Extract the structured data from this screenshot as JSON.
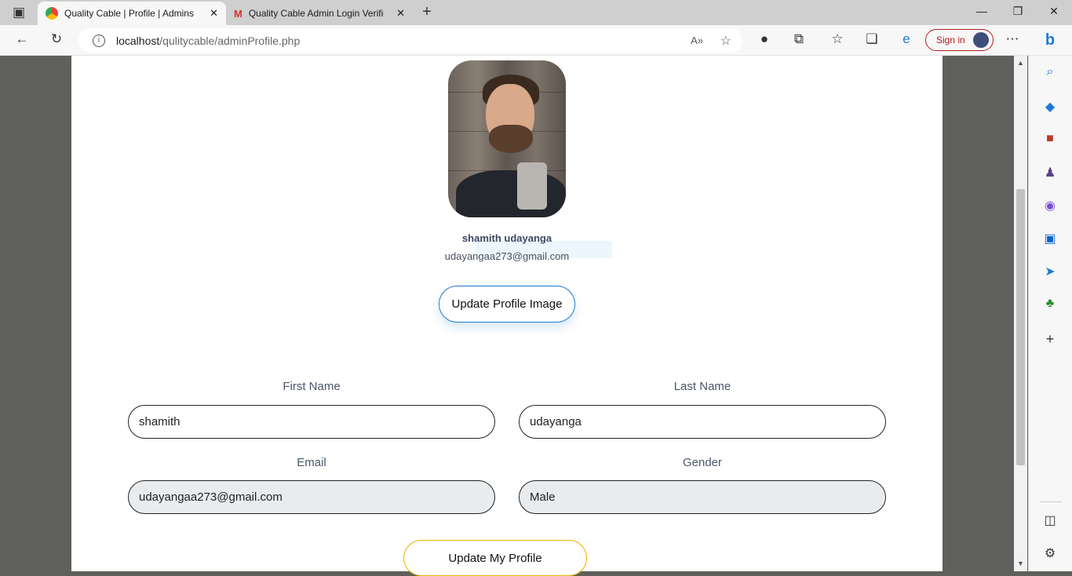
{
  "browser": {
    "tabs": [
      {
        "title": "Quality Cable | Profile | Admins",
        "favicon": "chrome-color-icon"
      },
      {
        "title": "Quality Cable Admin Login Verific",
        "favicon": "gmail-icon"
      }
    ],
    "url_host": "localhost",
    "url_path": "/qulitycable/adminProfile.php",
    "signin_label": "Sign in"
  },
  "profile": {
    "name": "shamith udayanga",
    "email": "udayangaa273@gmail.com",
    "update_image_label": "Update Profile Image"
  },
  "form": {
    "first_name_label": "First Name",
    "first_name_value": "shamith",
    "last_name_label": "Last Name",
    "last_name_value": "udayanga",
    "email_label": "Email",
    "email_value": "udayangaa273@gmail.com",
    "gender_label": "Gender",
    "gender_value": "Male",
    "submit_label": "Update My Profile"
  },
  "colors": {
    "accent_blue": "#1e7ad6",
    "accent_yellow": "#f0b400",
    "signin_red": "#b71c1c"
  }
}
